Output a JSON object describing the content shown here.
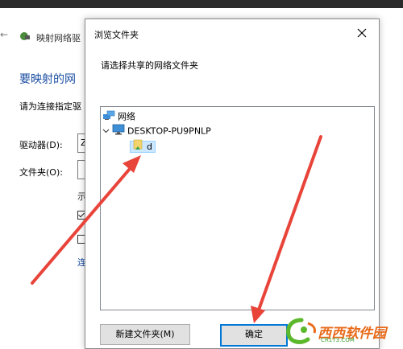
{
  "background_window": {
    "back_glyph": "←",
    "title": "映射网络驱",
    "heading": "要映射的网",
    "description": "请为连接指定驱",
    "drive_label": "驱动器(D):",
    "drive_value": "Z",
    "folder_label": "文件夹(O):",
    "hint": "示",
    "link": "连"
  },
  "dialog": {
    "title": "浏览文件夹",
    "prompt": "请选择共享的网络文件夹",
    "tree": {
      "network": "网络",
      "computer": "DESKTOP-PU9PNLP",
      "share": "d"
    },
    "new_folder_button": "新建文件夹(M)",
    "ok_button": "确定"
  },
  "colors": {
    "accent": "#0078d7",
    "heading": "#1a4da1",
    "arrow": "#e8443a",
    "selection": "#cce8ff"
  }
}
